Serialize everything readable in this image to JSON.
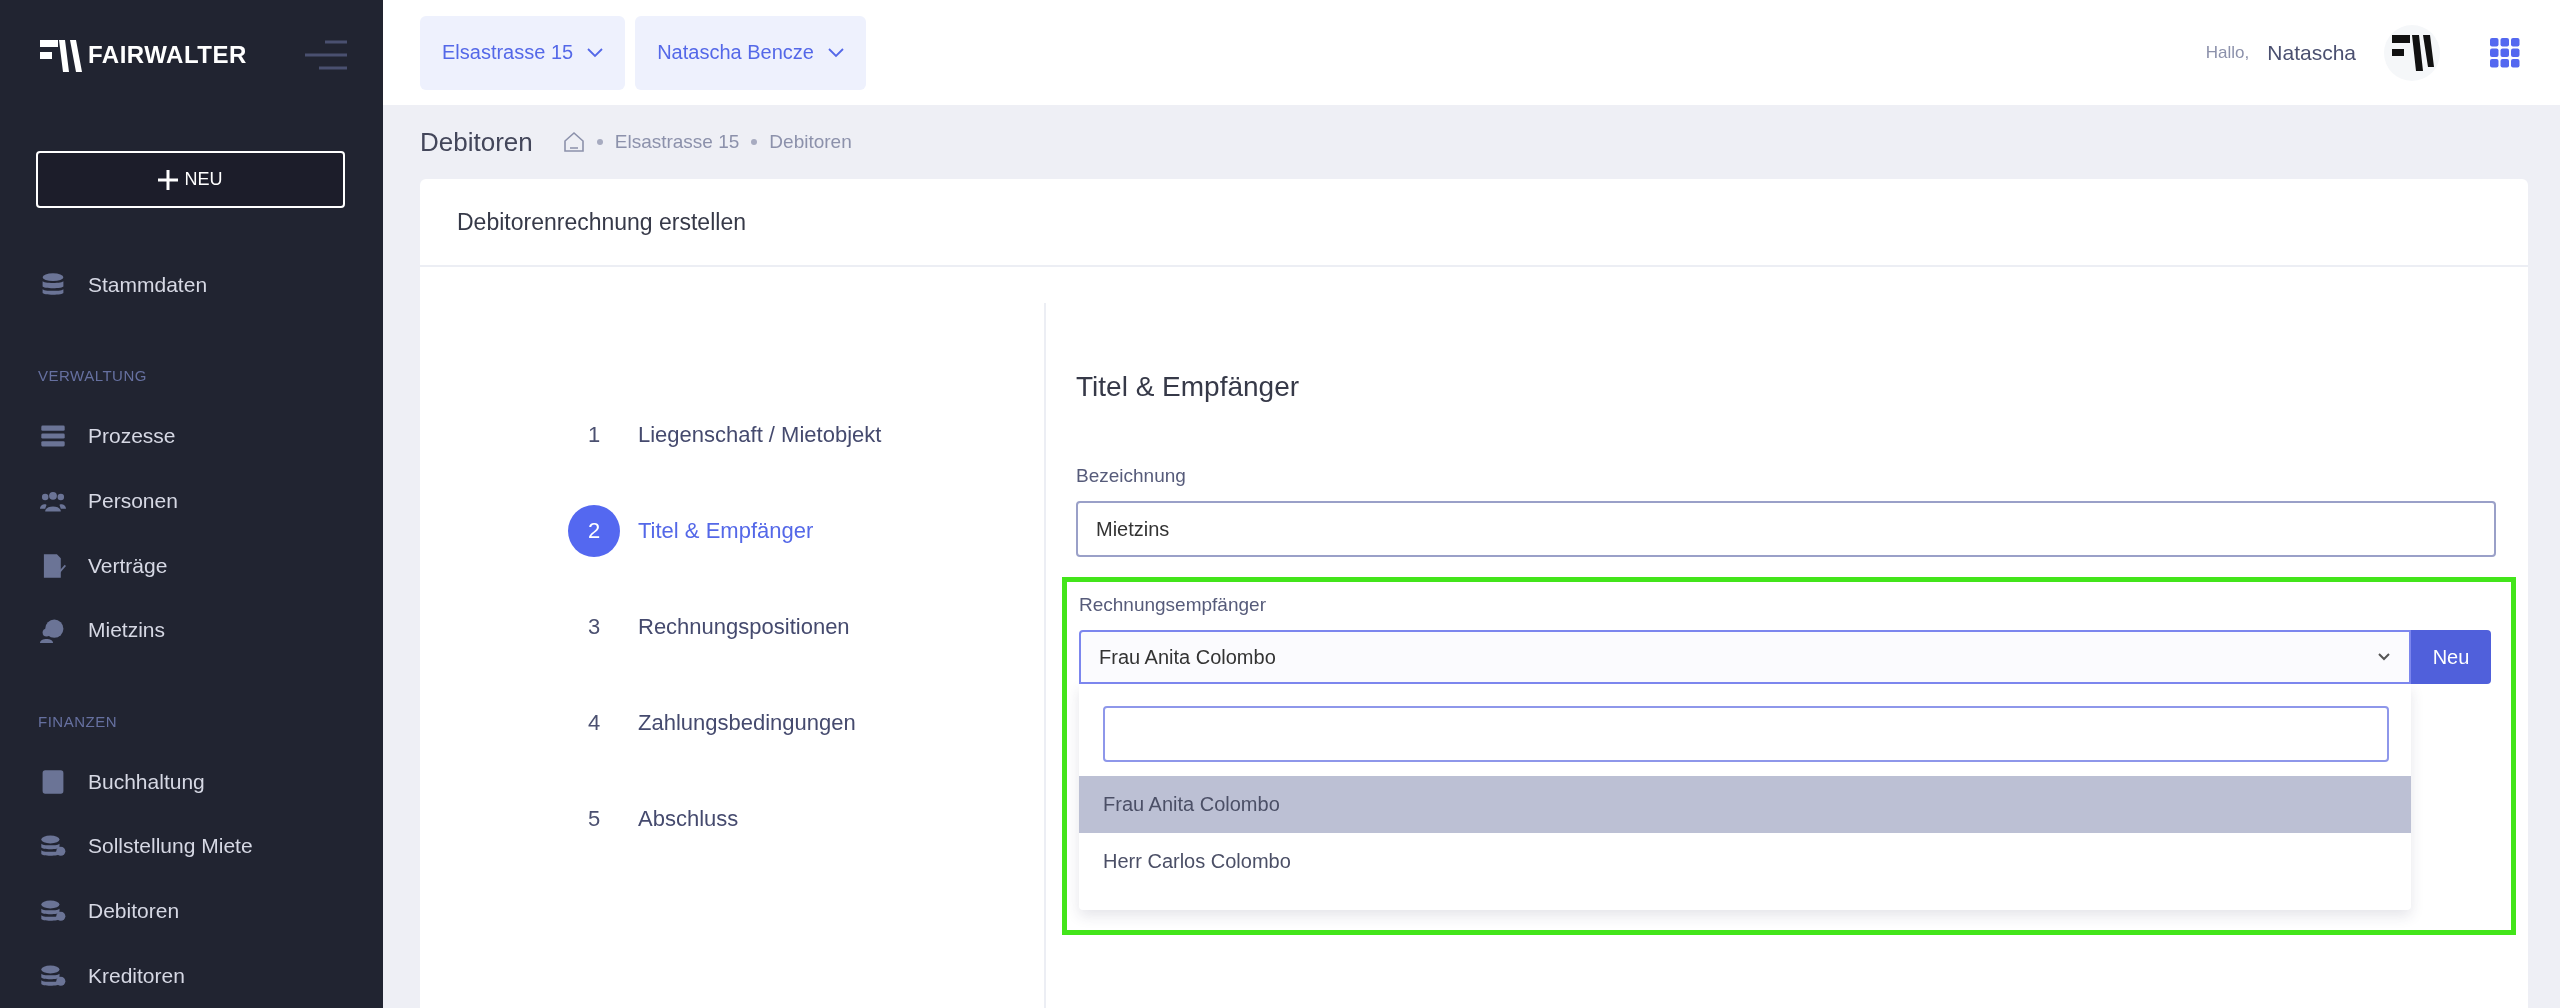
{
  "sidebar": {
    "brand": "FAIRWALTER",
    "new_button": "NEU",
    "sections": [
      {
        "items": [
          {
            "label": "Stammdaten"
          }
        ]
      },
      {
        "title": "VERWALTUNG",
        "items": [
          {
            "label": "Prozesse"
          },
          {
            "label": "Personen"
          },
          {
            "label": "Verträge"
          },
          {
            "label": "Mietzins"
          }
        ]
      },
      {
        "title": "FINANZEN",
        "items": [
          {
            "label": "Buchhaltung"
          },
          {
            "label": "Sollstellung Miete"
          },
          {
            "label": "Debitoren"
          },
          {
            "label": "Kreditoren"
          }
        ]
      }
    ]
  },
  "topbar": {
    "selectors": [
      {
        "label": "Elsastrasse 15"
      },
      {
        "label": "Natascha Bencze"
      }
    ],
    "greeting": "Hallo,",
    "user": "Natascha"
  },
  "page": {
    "title": "Debitoren",
    "breadcrumb": [
      "Elsastrasse 15",
      "Debitoren"
    ]
  },
  "card": {
    "title": "Debitorenrechnung erstellen",
    "steps": [
      {
        "number": "1",
        "label": "Liegenschaft / Mietobjekt",
        "selected": false
      },
      {
        "number": "2",
        "label": "Titel & Empfänger",
        "selected": true
      },
      {
        "number": "3",
        "label": "Rechnungspositionen",
        "selected": false
      },
      {
        "number": "4",
        "label": "Zahlungsbedingungen",
        "selected": false
      },
      {
        "number": "5",
        "label": "Abschluss",
        "selected": false
      }
    ],
    "form": {
      "title": "Titel & Empfänger",
      "designation": {
        "label": "Bezeichnung",
        "value": "Mietzins"
      },
      "recipient": {
        "label": "Rechnungsempfänger",
        "value": "Frau Anita Colombo",
        "button": "Neu",
        "highlighted": true,
        "expanded": true,
        "options": [
          {
            "label": "Frau Anita Colombo",
            "selected": true
          },
          {
            "label": "Herr Carlos Colombo",
            "selected": false
          }
        ]
      }
    }
  }
}
